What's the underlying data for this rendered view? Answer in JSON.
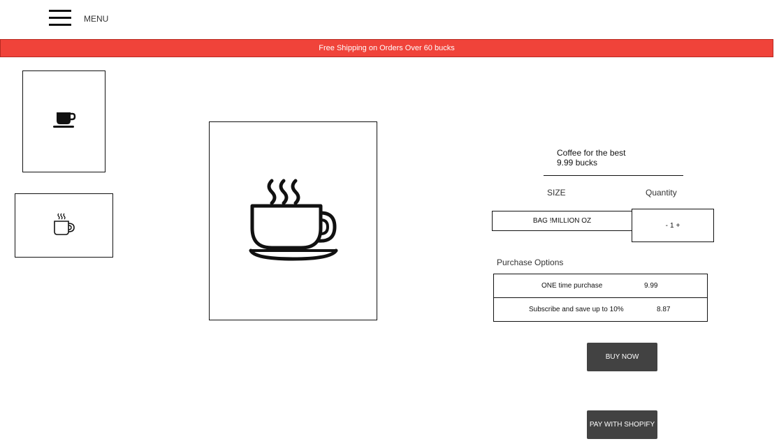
{
  "header": {
    "menu_label": "MENU",
    "menu_icon": "hamburger-icon"
  },
  "promo": {
    "text": "Free Shipping on Orders Over 60 bucks",
    "background": "#f0433a"
  },
  "gallery": {
    "thumbnails": [
      {
        "icon": "coffee-mug-icon"
      },
      {
        "icon": "steaming-mug-icon"
      }
    ],
    "main_icon": "steaming-coffee-cup-icon"
  },
  "product": {
    "name": "Coffee for the best",
    "price": "9.99 bucks"
  },
  "options": {
    "size_heading": "SIZE",
    "size_value": "BAG !MILLION OZ",
    "quantity_heading": "Quantity",
    "quantity_minus": "-",
    "quantity_value": "1",
    "quantity_plus": "+"
  },
  "purchase_options": {
    "heading": "Purchase Options",
    "rows": [
      {
        "label": "ONE time purchase",
        "price": "9.99"
      },
      {
        "label": "Subscribe and save up to 10%",
        "price": "8.87"
      }
    ]
  },
  "actions": {
    "buy_now": "BUY NOW",
    "pay_with_shopify": "PAY WITH SHOPIFY",
    "button_color": "#424242"
  }
}
